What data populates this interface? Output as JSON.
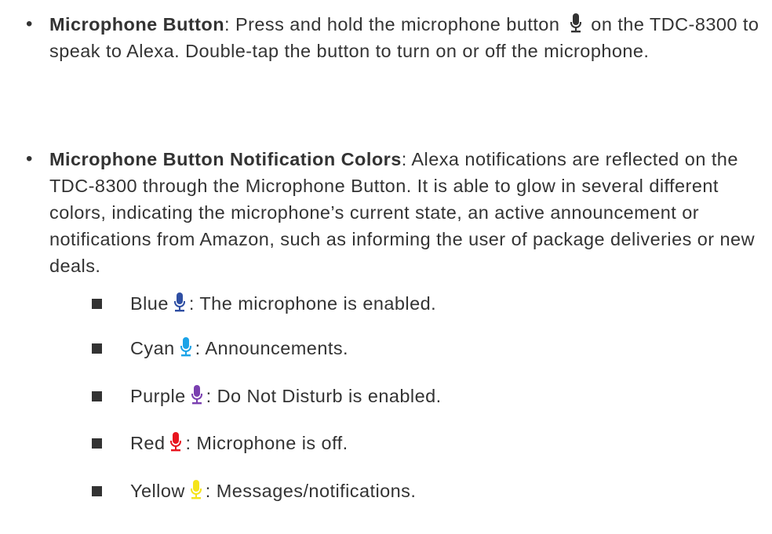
{
  "bullets": [
    {
      "title": "Microphone Button",
      "text_before_icon": ": Press and hold the microphone button ",
      "icon": "microphone-icon",
      "icon_color": "#333333",
      "text_after_icon": " on the TDC-8300 to speak to Alexa. Double-tap the button to turn on or off the microphone."
    },
    {
      "title": "Microphone Button Notification Colors",
      "text": ": Alexa notifications are reflected  on the TDC-8300 through the Microphone Button. It is able to glow in several different colors, indicating the microphone’s current state, an active announcement or notifications from Amazon, such as informing the user of package deliveries or new deals."
    }
  ],
  "colors": [
    {
      "name": "Blue",
      "hex": "#2f4fa3",
      "icon": "microphone-icon",
      "description": ": The microphone is enabled."
    },
    {
      "name": "Cyan",
      "hex": "#1aa3e8",
      "icon": "microphone-icon",
      "description": ": Announcements."
    },
    {
      "name": "Purple",
      "hex": "#7a3fb0",
      "icon": "microphone-icon",
      "description": ": Do Not Disturb is enabled."
    },
    {
      "name": "Red",
      "hex": "#e8141e",
      "icon": "microphone-icon",
      "description": ": Microphone is off."
    },
    {
      "name": "Yellow",
      "hex": "#f5e41a",
      "icon": "microphone-icon",
      "description": ": Messages/notifications."
    }
  ]
}
